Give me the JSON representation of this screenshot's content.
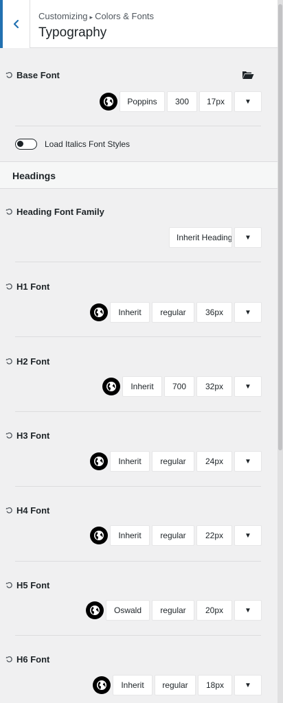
{
  "header": {
    "breadcrumb_root": "Customizing",
    "breadcrumb_sep": "▸",
    "breadcrumb_section": "Colors & Fonts",
    "title": "Typography"
  },
  "base_font": {
    "label": "Base Font",
    "family": "Poppins",
    "weight": "300",
    "size": "17px"
  },
  "italics": {
    "label": "Load Italics Font Styles",
    "enabled": false
  },
  "headings_section": {
    "title": "Headings"
  },
  "heading_family": {
    "label": "Heading Font Family",
    "value": "Inherit Heading"
  },
  "headings": [
    {
      "label": "H1 Font",
      "family": "Inherit",
      "weight": "regular",
      "size": "36px"
    },
    {
      "label": "H2 Font",
      "family": "Inherit",
      "weight": "700",
      "size": "32px"
    },
    {
      "label": "H3 Font",
      "family": "Inherit",
      "weight": "regular",
      "size": "24px"
    },
    {
      "label": "H4 Font",
      "family": "Inherit",
      "weight": "regular",
      "size": "22px"
    },
    {
      "label": "H5 Font",
      "family": "Oswald",
      "weight": "regular",
      "size": "20px"
    },
    {
      "label": "H6 Font",
      "family": "Inherit",
      "weight": "regular",
      "size": "18px"
    }
  ],
  "dropdown_glyph": "▼",
  "colors": {
    "accent": "#2271b1",
    "panel_bg": "#f0f0f1"
  },
  "icons": {
    "back": "chevron-left-icon",
    "reset": "reset-icon",
    "globe": "globe-icon",
    "folder": "folder-open-icon"
  }
}
